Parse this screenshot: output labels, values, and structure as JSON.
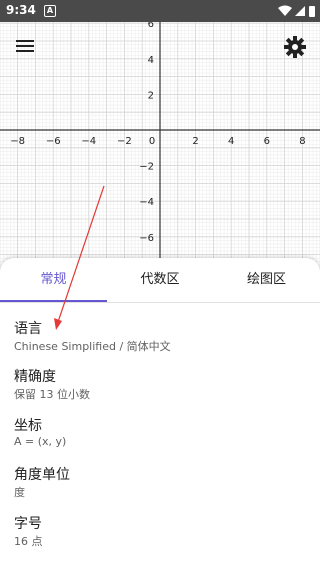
{
  "status_bar": {
    "time": "9:34",
    "app_icon_letter": "A"
  },
  "graph": {
    "x_ticks": [
      "−8",
      "−6",
      "−4",
      "−2",
      "0",
      "2",
      "4",
      "6",
      "8"
    ],
    "y_ticks": [
      "6",
      "4",
      "2",
      "−2",
      "−4",
      "−6"
    ],
    "x_range": [
      -9,
      9
    ],
    "y_range": [
      -7.6,
      6.4
    ]
  },
  "toolbar": {
    "menu_icon": "menu-icon",
    "settings_icon": "gear-icon"
  },
  "tabs": [
    {
      "label": "常规",
      "active": true
    },
    {
      "label": "代数区",
      "active": false
    },
    {
      "label": "绘图区",
      "active": false
    }
  ],
  "settings": [
    {
      "title": "语言",
      "value": "Chinese Simplified / 简体中文"
    },
    {
      "title": "精确度",
      "value": "保留 13 位小数"
    },
    {
      "title": "坐标",
      "value": "A = (x, y)"
    },
    {
      "title": "角度单位",
      "value": "度"
    },
    {
      "title": "字号",
      "value": "16 点"
    }
  ],
  "colors": {
    "accent": "#6557d2",
    "annotation_arrow": "#e53935",
    "status_bar": "#4a4a4a"
  }
}
